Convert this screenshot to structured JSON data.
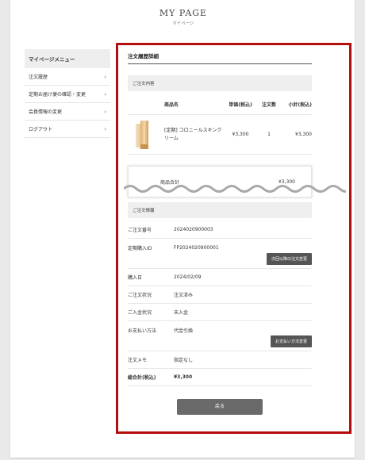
{
  "header": {
    "title": "MY PAGE",
    "subtitle": "マイページ"
  },
  "sidebar": {
    "title": "マイページメニュー",
    "items": [
      {
        "label": "注文履歴"
      },
      {
        "label": "定期お届け便の確認・変更"
      },
      {
        "label": "会員情報の変更"
      },
      {
        "label": "ログアウト"
      }
    ],
    "chevron": "›"
  },
  "main": {
    "title": "注文履歴詳細",
    "order_contents_label": "ご注文内容",
    "columns": [
      "商品名",
      "単価(税込)",
      "注文数",
      "小計(税込)"
    ],
    "items": [
      {
        "name": "[定期] コロニールスキンクリーム",
        "price": "¥3,300",
        "qty": "1",
        "subtotal": "¥3,300"
      }
    ],
    "product_total_label": "商品合計",
    "product_total_value": "¥3,300",
    "order_info_label": "ご注文情報",
    "info": {
      "order_no_label": "ご注文番号",
      "order_no": "2024020900003",
      "sub_id_label": "定期購入ID",
      "sub_id": "FP2024020900001",
      "next_change_button": "次回以降の注文変更",
      "purchase_date_label": "購入日",
      "purchase_date": "2024/02/09",
      "order_status_label": "ご注文状況",
      "order_status": "注文済み",
      "payment_status_label": "ご入金状況",
      "payment_status": "未入金",
      "payment_method_label": "お支払い方法",
      "payment_method": "代金引換",
      "payment_change_button": "お支払い方法変更",
      "memo_label": "注文メモ",
      "memo": "指定なし",
      "grand_total_label": "総合計(税込)",
      "grand_total": "¥3,300"
    },
    "back_button": "戻る"
  },
  "colors": {
    "highlight_border": "#b30d0d",
    "button_dark": "#555555",
    "band_bg": "#efefef"
  }
}
